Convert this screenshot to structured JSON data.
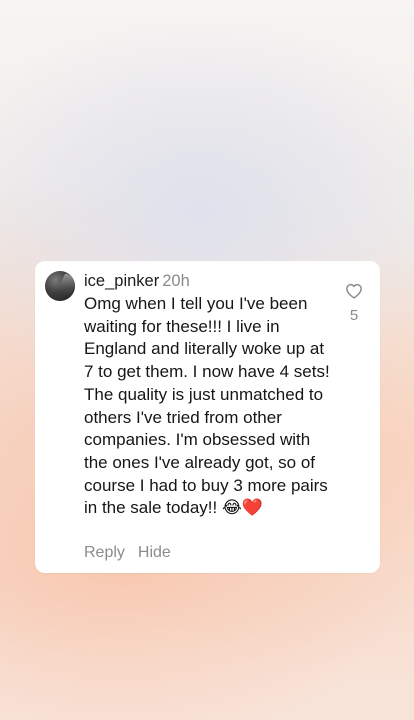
{
  "comment": {
    "username": "ice_pinker",
    "timestamp": "20h",
    "text": "Omg when I tell you I've been waiting for these!!! I live in England and literally woke up at 7 to get them. I now have 4 sets! The quality is just unmatched to others I've tried from other companies. I'm obsessed with the ones I've already got, so of course I had to buy 3 more pairs in the sale today!!",
    "emojis": [
      "😂",
      "❤️"
    ],
    "like_count": "5"
  },
  "actions": {
    "reply_label": "Reply",
    "hide_label": "Hide"
  },
  "icons": {
    "like": "heart-outline-icon",
    "avatar": "profile-avatar"
  },
  "colors": {
    "card_background": "#ffffff",
    "text_primary": "#161616",
    "text_secondary": "#8a8a8a",
    "heart_emoji": "#e0202a"
  }
}
